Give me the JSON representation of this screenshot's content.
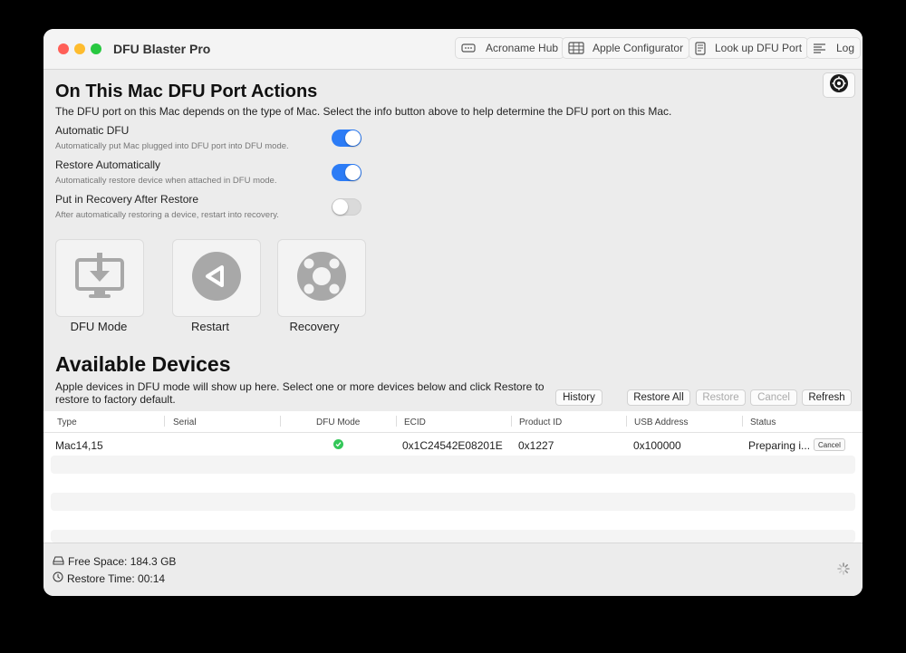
{
  "window": {
    "title": "DFU Blaster Pro"
  },
  "toolbar": {
    "acroname_hub": "Acroname Hub",
    "apple_configurator": "Apple Configurator",
    "lookup_dfu_port": "Look up DFU Port",
    "log": "Log"
  },
  "port_actions": {
    "heading": "On This Mac DFU Port Actions",
    "description": "The DFU port on this Mac depends on the type of Mac. Select the info button above to help determine the DFU port on this Mac.",
    "options": [
      {
        "title": "Automatic DFU",
        "subtitle": "Automatically put Mac plugged into DFU port into DFU mode.",
        "enabled": true
      },
      {
        "title": "Restore Automatically",
        "subtitle": "Automatically restore device when attached in DFU mode.",
        "enabled": true
      },
      {
        "title": "Put in Recovery After Restore",
        "subtitle": "After automatically restoring a device, restart into recovery.",
        "enabled": false
      }
    ],
    "actions": [
      {
        "label": "DFU Mode",
        "icon": "dfu-mode-icon"
      },
      {
        "label": "Restart",
        "icon": "restart-icon"
      },
      {
        "label": "Recovery",
        "icon": "recovery-icon"
      }
    ]
  },
  "devices": {
    "heading": "Available Devices",
    "description_line1": "Apple devices in DFU mode will show up here. Select one or more devices below and click Restore to",
    "description_line2": "restore to factory default.",
    "buttons": {
      "history": "History",
      "restore_all": "Restore All",
      "restore": "Restore",
      "cancel": "Cancel",
      "refresh": "Refresh"
    },
    "columns": [
      "Type",
      "Serial",
      "DFU Mode",
      "ECID",
      "Product ID",
      "USB Address",
      "Status"
    ],
    "rows": [
      {
        "type": "Mac14,15",
        "serial": "",
        "dfu_mode": "check",
        "ecid": "0x1C24542E08201E",
        "product_id": "0x1227",
        "usb_address": "0x100000",
        "status": "Preparing i...",
        "action": "Cancel"
      }
    ]
  },
  "footer": {
    "free_space": "Free Space: 184.3 GB",
    "restore_time": "Restore Time: 00:14"
  },
  "colors": {
    "accent": "#2c7cf6",
    "success": "#34c759"
  }
}
